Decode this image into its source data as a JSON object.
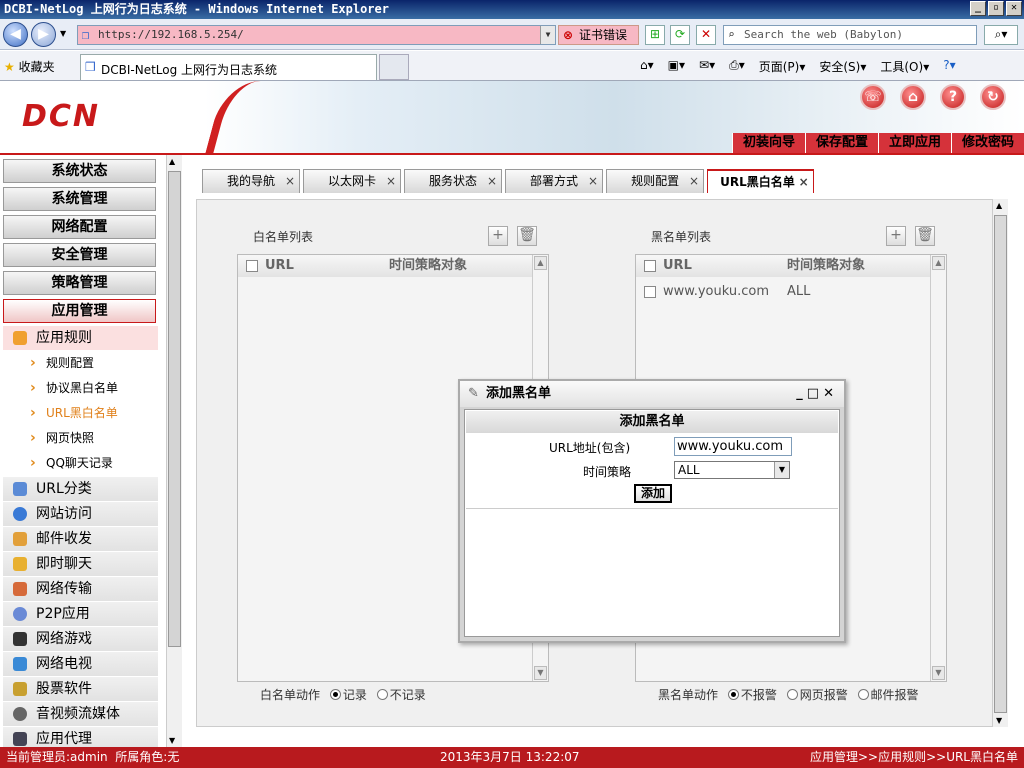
{
  "browser": {
    "title": "DCBI-NetLog 上网行为日志系统 - Windows Internet Explorer",
    "url": "https://192.168.5.254/",
    "cert_error": "证书错误",
    "search_placeholder": "Search the web (Babylon)",
    "favorites_label": "收藏夹",
    "tab_title": "DCBI-NetLog 上网行为日志系统",
    "cmd_page": "页面(P)",
    "cmd_safety": "安全(S)",
    "cmd_tools": "工具(O)"
  },
  "header": {
    "logo": "DCN",
    "menu": [
      "初装向导",
      "保存配置",
      "立即应用",
      "修改密码"
    ]
  },
  "sidebar": {
    "categories": [
      "系统状态",
      "系统管理",
      "网络配置",
      "安全管理",
      "策略管理",
      "应用管理"
    ],
    "open_group": "应用规则",
    "leaves": [
      "规则配置",
      "协议黑白名单",
      "URL黑白名单",
      "网页快照",
      "QQ聊天记录"
    ],
    "groups": [
      "URL分类",
      "网站访问",
      "邮件收发",
      "即时聊天",
      "网络传输",
      "P2P应用",
      "网络游戏",
      "网络电视",
      "股票软件",
      "音视频流媒体",
      "应用代理"
    ]
  },
  "tabs": [
    "我的导航",
    "以太网卡",
    "服务状态",
    "部署方式",
    "规则配置",
    "URL黑白名单"
  ],
  "whitelist": {
    "title": "白名单列表",
    "col_url": "URL",
    "col_policy": "时间策略对象",
    "rows": [],
    "action_label": "白名单动作",
    "opt_record": "记录",
    "opt_norecord": "不记录"
  },
  "blacklist": {
    "title": "黑名单列表",
    "col_url": "URL",
    "col_policy": "时间策略对象",
    "rows": [
      {
        "url": "www.youku.com",
        "policy": "ALL"
      }
    ],
    "action_label": "黑名单动作",
    "opt_noalarm": "不报警",
    "opt_webalarm": "网页报警",
    "opt_mailalarm": "邮件报警"
  },
  "dialog": {
    "title": "添加黑名单",
    "header": "添加黑名单",
    "url_label": "URL地址(包含)",
    "url_value": "www.youku.com",
    "policy_label": "时间策略",
    "policy_value": "ALL",
    "add_button": "添加"
  },
  "status": {
    "user": "当前管理员:admin  所属角色:无",
    "datetime": "2013年3月7日 13:22:07",
    "breadcrumb": "应用管理>>应用规则>>URL黑白名单"
  },
  "colors": {
    "brand_red": "#c8191a",
    "selected_leaf": "#e0801a"
  }
}
